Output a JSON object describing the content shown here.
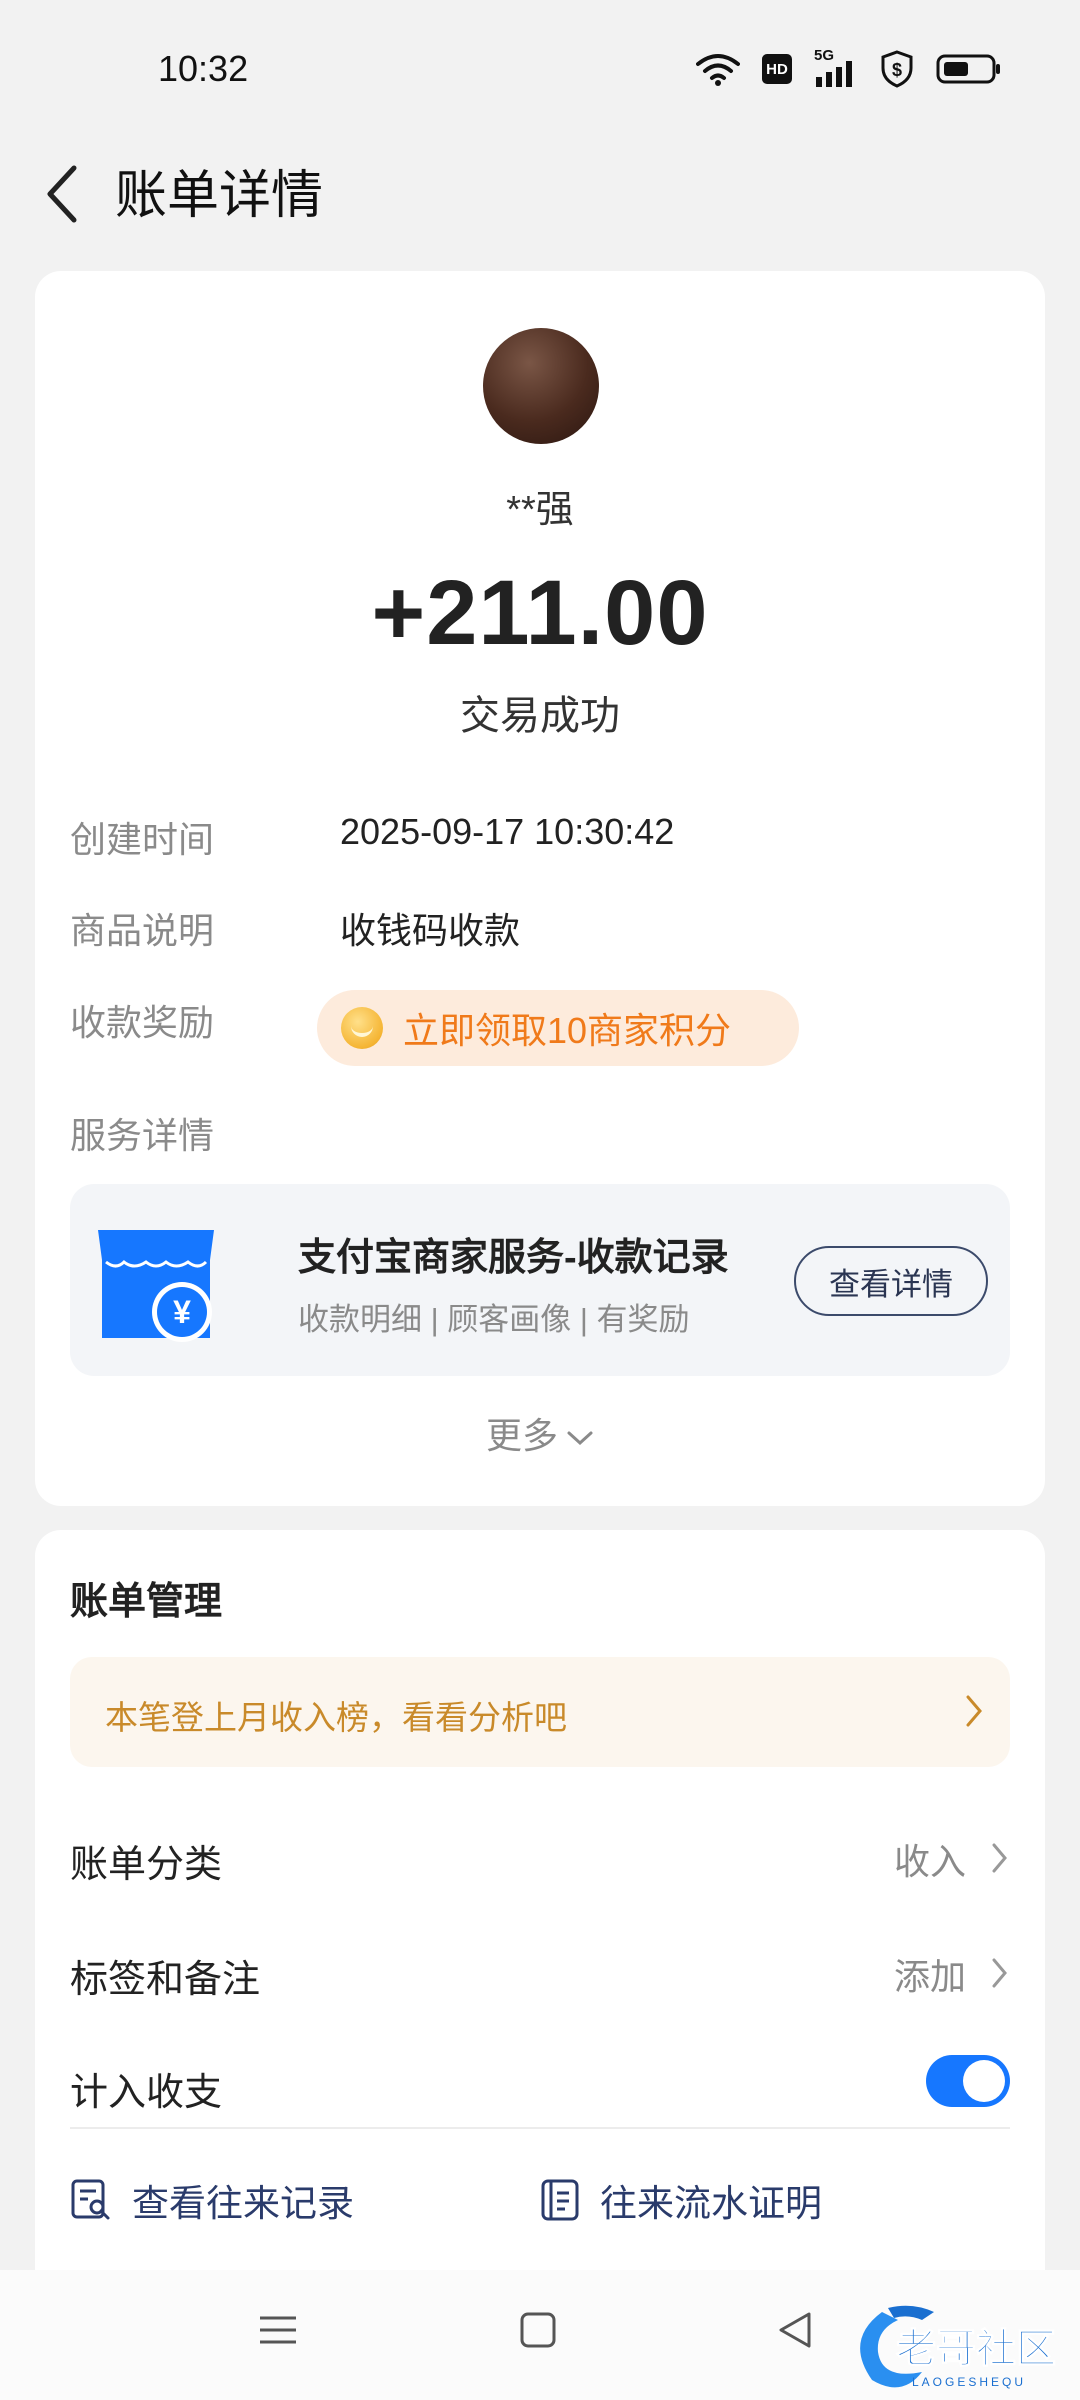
{
  "status_bar": {
    "time": "10:32",
    "network": "5G",
    "hd_badge": "HD"
  },
  "header": {
    "title": "账单详情"
  },
  "transaction": {
    "payer_name": "**强",
    "amount": "+211.00",
    "status": "交易成功"
  },
  "details": {
    "created_label": "创建时间",
    "created_value": "2025-09-17 10:30:42",
    "product_label": "商品说明",
    "product_value": "收钱码收款",
    "reward_label": "收款奖励",
    "reward_text": "立即领取10商家积分",
    "service_label": "服务详情"
  },
  "service_card": {
    "title": "支付宝商家服务-收款记录",
    "subtitle": "收款明细 | 顾客画像 | 有奖励",
    "button": "查看详情"
  },
  "more": {
    "label": "更多"
  },
  "management": {
    "title": "账单管理",
    "banner": "本笔登上月收入榜，看看分析吧",
    "category_label": "账单分类",
    "category_value": "收入",
    "tags_label": "标签和备注",
    "tags_value": "添加",
    "include_label": "计入收支",
    "include_enabled": true,
    "link_records": "查看往来记录",
    "link_statement": "往来流水证明"
  },
  "watermark": {
    "text": "老哥社区",
    "subtext": "LAOGESHEQU"
  },
  "colors": {
    "accent_blue": "#1677ff",
    "reward_orange": "#f07a1a",
    "banner_gold": "#c98a2a",
    "link_navy": "#2a3b6b"
  }
}
